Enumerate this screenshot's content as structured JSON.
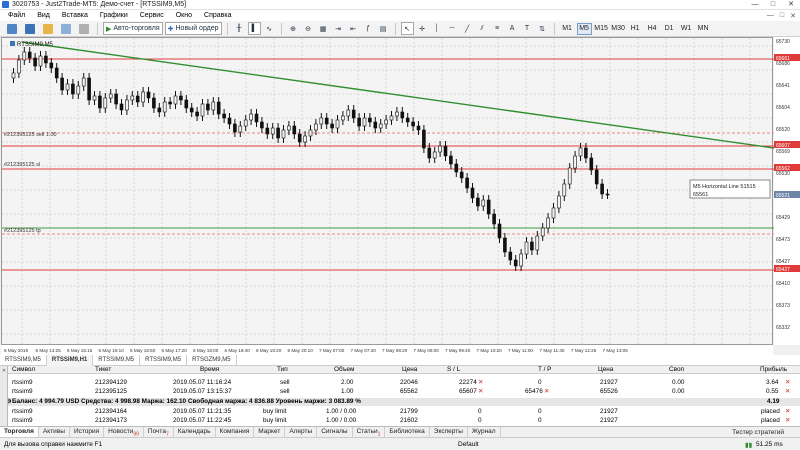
{
  "window": {
    "title": "3020753 - Just2Trade-MT5: Демо-счет - [RTSSIM9,M5]",
    "controls": [
      "—",
      "□",
      "✕"
    ]
  },
  "menu": {
    "items": [
      "Файл",
      "Вид",
      "Вставка",
      "Графики",
      "Сервис",
      "Окно",
      "Справка"
    ],
    "right_controls": [
      "—",
      "□",
      "✕"
    ]
  },
  "toolbar": {
    "algo_trading": "Авто-торговля",
    "new_order": "Новый ордер",
    "timeframes": [
      "M1",
      "M5",
      "M15",
      "M30",
      "H1",
      "H4",
      "D1",
      "W1",
      "MN"
    ],
    "active_timeframe": "M5"
  },
  "chart": {
    "symbol_label": "RTSSIM9,M5",
    "marker_labels": {
      "order_sell": "#212395125 sell 1.00",
      "order_sl": "#212395125 sl",
      "order_tp": "#212395125 tp"
    },
    "tooltip": {
      "line1": "M5 Horizontal Line 51515",
      "line2": "65561"
    },
    "price_labels": [
      "65730",
      "65686",
      "65641",
      "65604",
      "65520",
      "65569",
      "65530",
      "65495",
      "65429",
      "65473",
      "65427",
      "65410",
      "65373",
      "65332"
    ],
    "highlight_prices": [
      {
        "text": "65661",
        "color": "#e03b3b"
      },
      {
        "text": "65607",
        "color": "#e03b3b"
      },
      {
        "text": "65562",
        "color": "#e03b3b"
      },
      {
        "text": "65427",
        "color": "#e03b3b"
      },
      {
        "text": "65521",
        "color": "#6d86a6"
      }
    ],
    "time_labels": [
      "6 May 2019",
      "6 May 14:25",
      "6 May 15:15",
      "6 May 16:10",
      "6 May 16:50",
      "6 May 17:20",
      "6 May 18:00",
      "6 May 18:40",
      "6 May 19:20",
      "6 May 20:10",
      "7 May 07:00",
      "7 May 07:40",
      "7 May 08:20",
      "7 May 09:00",
      "7 May 09:40",
      "7 May 10:20",
      "7 May 11:00",
      "7 May 11:40",
      "7 May 12:25",
      "7 May 13:05"
    ],
    "colors": {
      "trendline": "#2f8f2f",
      "red_line": "#e03b3b",
      "green_line": "#3c9b3c",
      "candle": "#111111"
    }
  },
  "chart_tabs": [
    "RTSSIM9,M5",
    "RTSSIM9,H1",
    "RTSSIM9,M5",
    "RTSSIM9,M5",
    "RTSGZM9,M5"
  ],
  "terminal": {
    "headers": [
      "Символ",
      "Тикет",
      "Время",
      "Тип",
      "Объем",
      "Цена",
      "S / L",
      "T / P",
      "Цена",
      "Своп",
      "Прибыль"
    ],
    "positions": [
      {
        "symbol": "rtssim9",
        "ticket": "212394129",
        "time": "2019.05.07 11:16:24",
        "type": "sell",
        "volume": "2.00",
        "price": "22046",
        "sl": "22274",
        "tp": "0",
        "cur_price": "21927",
        "swap": "0.00",
        "profit": "3.64"
      },
      {
        "symbol": "rtssim9",
        "ticket": "212395125",
        "time": "2019.05.07 13:15:37",
        "type": "sell",
        "volume": "1.00",
        "price": "65562",
        "sl": "65607",
        "tp": "65476",
        "cur_price": "65526",
        "swap": "0.00",
        "profit": "0.55"
      }
    ],
    "balance_line": "Баланс: 4 994.79 USD  Средства: 4 998.98  Маржа: 162.10  Свободная маржа: 4 836.88  Уровень маржи: 3 083.89 %",
    "balance_profit": "4.19",
    "orders": [
      {
        "symbol": "rtssim9",
        "ticket": "212394164",
        "time": "2019.05.07 11:21:35",
        "type": "buy limit",
        "volume": "1.00 / 0.00",
        "price": "21799",
        "sl": "0",
        "tp": "0",
        "cur_price": "21927",
        "status": "placed"
      },
      {
        "symbol": "rtssim9",
        "ticket": "212394173",
        "time": "2019.05.07 11:22:45",
        "type": "buy limit",
        "volume": "1.00 / 0.00",
        "price": "21602",
        "sl": "0",
        "tp": "0",
        "cur_price": "21927",
        "status": "placed"
      }
    ]
  },
  "bottom_tabs": [
    "Торговля",
    "Активы",
    "История",
    "Новости",
    "Почта",
    "Календарь",
    "Компания",
    "Маркет",
    "Алерты",
    "Сигналы",
    "Статьи",
    "Библиотека",
    "Эксперты",
    "Журнал"
  ],
  "bottom_tab_badges": {
    "Новости": "99",
    "Почта": "7",
    "Статьи": "1"
  },
  "strategy_tester": "Тестер стратегий",
  "status": {
    "help": "Для вызова справки нажмите F1",
    "profile": "Default",
    "connection": "51.25 ms"
  }
}
